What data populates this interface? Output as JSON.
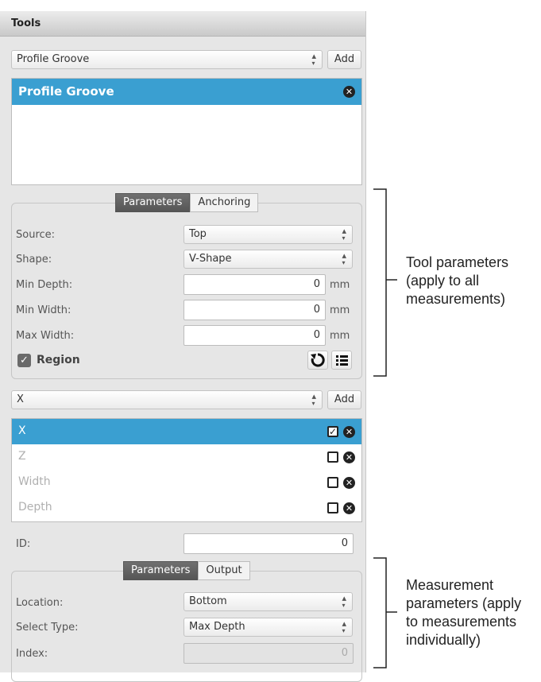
{
  "header": {
    "title": "Tools"
  },
  "tool_select": {
    "value": "Profile Groove",
    "add_label": "Add"
  },
  "tool_list": {
    "items": [
      {
        "label": "Profile Groove",
        "selected": true
      }
    ]
  },
  "tool_tabs": {
    "parameters": "Parameters",
    "anchoring": "Anchoring"
  },
  "tool_params": {
    "source": {
      "label": "Source:",
      "value": "Top"
    },
    "shape": {
      "label": "Shape:",
      "value": "V-Shape"
    },
    "min_depth": {
      "label": "Min Depth:",
      "value": "0",
      "unit": "mm"
    },
    "min_width": {
      "label": "Min Width:",
      "value": "0",
      "unit": "mm"
    },
    "max_width": {
      "label": "Max Width:",
      "value": "0",
      "unit": "mm"
    },
    "region": {
      "label": "Region",
      "checked": true
    }
  },
  "measure_select": {
    "value": "X",
    "add_label": "Add"
  },
  "measure_list": {
    "items": [
      {
        "label": "X",
        "selected": true,
        "checked": true
      },
      {
        "label": "Z",
        "selected": false,
        "checked": false
      },
      {
        "label": "Width",
        "selected": false,
        "checked": false
      },
      {
        "label": "Depth",
        "selected": false,
        "checked": false
      }
    ]
  },
  "id_field": {
    "label": "ID:",
    "value": "0"
  },
  "measure_tabs": {
    "parameters": "Parameters",
    "output": "Output"
  },
  "measure_params": {
    "location": {
      "label": "Location:",
      "value": "Bottom"
    },
    "select_type": {
      "label": "Select Type:",
      "value": "Max Depth"
    },
    "index": {
      "label": "Index:",
      "value": "0"
    }
  },
  "annotations": {
    "tool": [
      "Tool parameters",
      "(apply to all",
      "measurements)"
    ],
    "measurement": [
      "Measurement",
      "parameters (apply",
      "to measurements",
      "individually)"
    ]
  }
}
